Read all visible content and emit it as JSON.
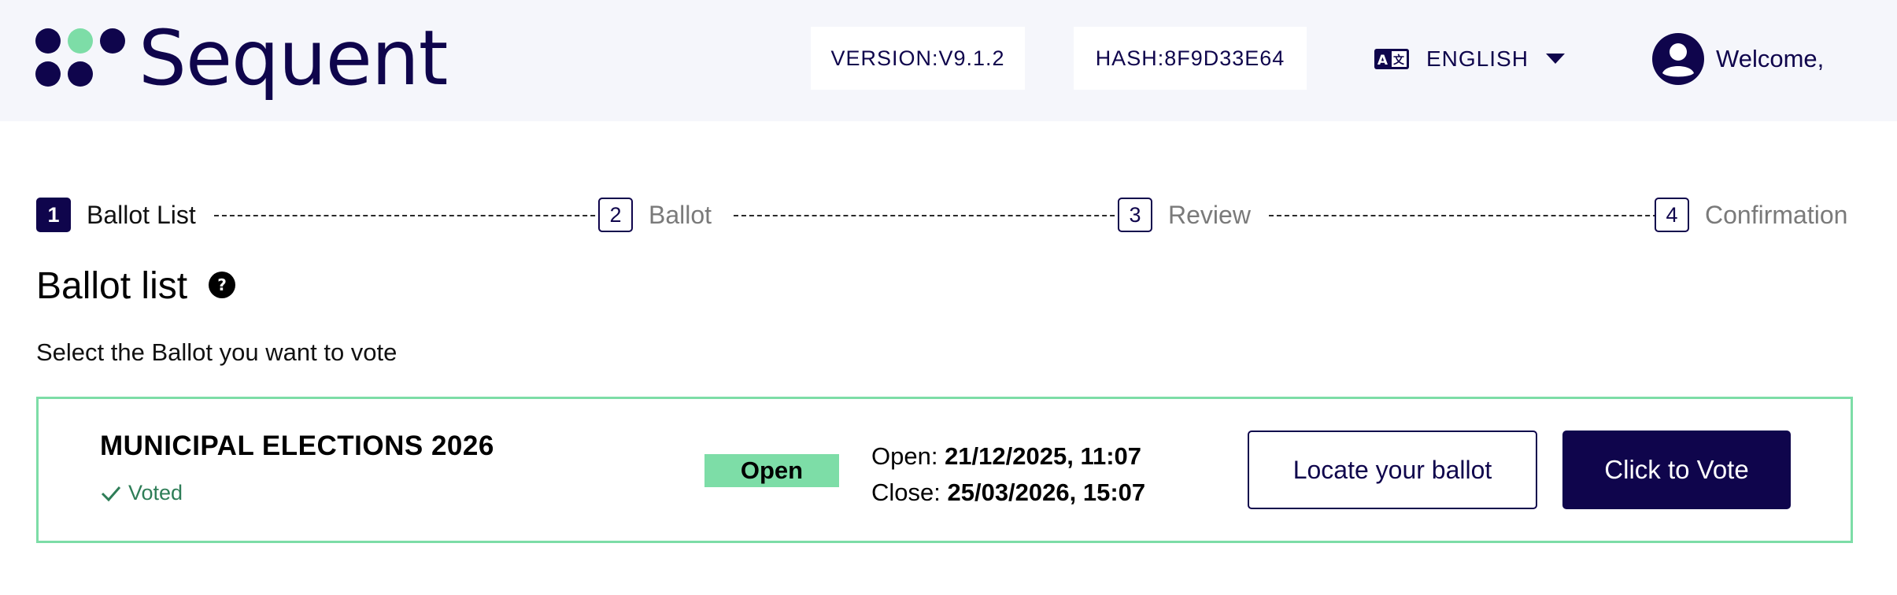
{
  "brand": {
    "name": "Sequent",
    "primary_color": "#0f054c",
    "accent_color": "#7ddda7",
    "logo_icon": "four-dots-logo-icon"
  },
  "header": {
    "version": "VERSION:V9.1.2",
    "hash": "HASH:8F9D33E64",
    "language": {
      "icon": "translate-icon",
      "selected": "ENGLISH",
      "caret_icon": "caret-down-icon"
    },
    "user": {
      "icon": "account-circle-icon",
      "greeting": "Welcome,"
    }
  },
  "stepper": {
    "steps": [
      {
        "number": "1",
        "label": "Ballot List",
        "active": true
      },
      {
        "number": "2",
        "label": "Ballot",
        "active": false
      },
      {
        "number": "3",
        "label": "Review",
        "active": false
      },
      {
        "number": "4",
        "label": "Confirmation",
        "active": false
      }
    ]
  },
  "main": {
    "title": "Ballot list",
    "help_icon": "help-circle-icon",
    "subtitle": "Select the Ballot you want to vote",
    "ballots": [
      {
        "title": "MUNICIPAL ELECTIONS 2026",
        "voted_label": "Voted",
        "voted_icon": "check-icon",
        "status": "Open",
        "open_label": "Open:",
        "open_date": "21/12/2025, 11:07",
        "close_label": "Close:",
        "close_date": "25/03/2026, 15:07",
        "locate_button": "Locate your ballot",
        "vote_button": "Click to Vote"
      }
    ]
  }
}
